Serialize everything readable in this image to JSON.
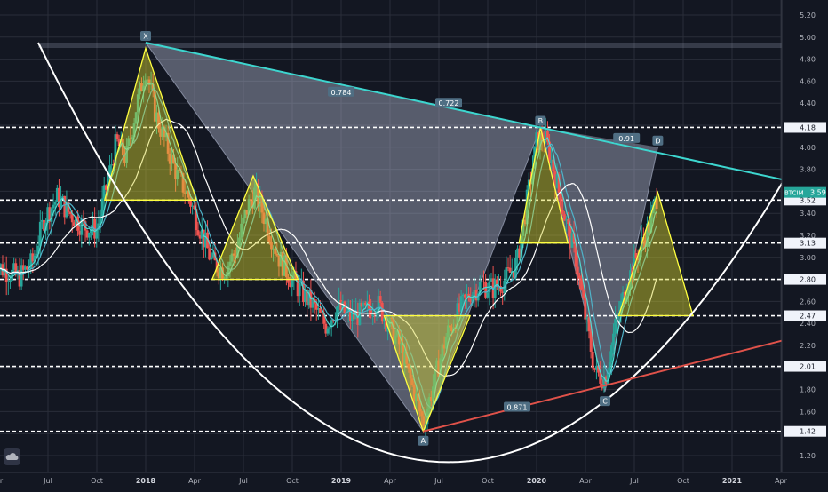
{
  "symbol": "BTCIM",
  "price_tag": "3.59",
  "logo_icon": "tradingview-cloud-icon",
  "colors": {
    "background": "#131722",
    "grid": "#2a2e39",
    "up": "#26a69a",
    "down": "#ef5350",
    "level_line": "#ffffff",
    "trend_top": "#3dd6cf",
    "trend_bottom": "#e0524a",
    "xabcd_fill": "#b4bdd4",
    "triangle_stroke": "#ffff40",
    "triangle_fill": "#d6d42e",
    "ma_fast": "#52d9d2",
    "ma_mid": "#4fb2c8",
    "ma_slow": "#ffffff",
    "price_tag_bg": "#26a69a"
  },
  "chart_data": {
    "type": "candlestick",
    "y_axis": {
      "ticks": [
        "5.20",
        "5.00",
        "4.80",
        "4.60",
        "4.40",
        "4.20",
        "4.00",
        "3.80",
        "3.60",
        "3.40",
        "3.20",
        "3.00",
        "2.80",
        "2.60",
        "2.40",
        "2.20",
        "2.00",
        "1.80",
        "1.60",
        "1.40",
        "1.20"
      ],
      "range": [
        1.12,
        5.27
      ]
    },
    "x_axis": {
      "ticks": [
        {
          "label": "pr",
          "t": 2017.25,
          "bold": false
        },
        {
          "label": "Jul",
          "t": 2017.5,
          "bold": false
        },
        {
          "label": "Oct",
          "t": 2017.75,
          "bold": false
        },
        {
          "label": "2018",
          "t": 2018.0,
          "bold": true
        },
        {
          "label": "Apr",
          "t": 2018.25,
          "bold": false
        },
        {
          "label": "Jul",
          "t": 2018.5,
          "bold": false
        },
        {
          "label": "Oct",
          "t": 2018.75,
          "bold": false
        },
        {
          "label": "2019",
          "t": 2019.0,
          "bold": true
        },
        {
          "label": "Apr",
          "t": 2019.25,
          "bold": false
        },
        {
          "label": "Jul",
          "t": 2019.5,
          "bold": false
        },
        {
          "label": "Oct",
          "t": 2019.75,
          "bold": false
        },
        {
          "label": "2020",
          "t": 2020.0,
          "bold": true
        },
        {
          "label": "Apr",
          "t": 2020.25,
          "bold": false
        },
        {
          "label": "Jul",
          "t": 2020.5,
          "bold": false
        },
        {
          "label": "Oct",
          "t": 2020.75,
          "bold": false
        },
        {
          "label": "2021",
          "t": 2021.0,
          "bold": true
        },
        {
          "label": "Apr",
          "t": 2021.25,
          "bold": false
        }
      ]
    },
    "levels": [
      "4.18",
      "3.52",
      "3.13",
      "2.80",
      "2.47",
      "2.01",
      "1.42"
    ],
    "xabcd_pattern": {
      "points": [
        {
          "label": "X",
          "t": 2018.0,
          "price": 4.95
        },
        {
          "label": "A",
          "t": 2019.42,
          "price": 1.42
        },
        {
          "label": "B",
          "t": 2020.02,
          "price": 4.18
        },
        {
          "label": "C",
          "t": 2020.35,
          "price": 1.78
        },
        {
          "label": "D",
          "t": 2020.62,
          "price": 4.0
        }
      ],
      "ratios": [
        {
          "label": "0.784",
          "t": 2019.0,
          "price": 4.5
        },
        {
          "label": "0.722",
          "t": 2019.55,
          "price": 4.4
        },
        {
          "label": "0.91",
          "t": 2020.46,
          "price": 4.08
        },
        {
          "label": "0.871",
          "t": 2019.9,
          "price": 1.64
        }
      ]
    },
    "trendlines": [
      {
        "name": "resistance",
        "from": {
          "t": 2018.0,
          "price": 4.95
        },
        "to": {
          "t": 2021.65,
          "price": 3.66
        }
      },
      {
        "name": "support",
        "from": {
          "t": 2019.42,
          "price": 1.42
        },
        "to": {
          "t": 2021.65,
          "price": 2.3
        }
      }
    ],
    "cup_curve": {
      "left": {
        "t": 2017.45,
        "price": 4.95
      },
      "bottom": {
        "t": 2019.55,
        "price": 1.14
      },
      "right": {
        "t": 2021.65,
        "price": 4.98
      }
    },
    "range_band": {
      "top": 4.95,
      "t_from": 2017.45,
      "t_to": 2021.65
    },
    "triangles": [
      {
        "apex": {
          "t": 2018.0,
          "price": 4.9
        },
        "base_left": {
          "t": 2017.79,
          "price": 3.52
        },
        "base_right": {
          "t": 2018.26,
          "price": 3.52
        }
      },
      {
        "apex": {
          "t": 2018.55,
          "price": 3.74
        },
        "base_left": {
          "t": 2018.34,
          "price": 2.8
        },
        "base_right": {
          "t": 2018.78,
          "price": 2.8
        }
      },
      {
        "apex": {
          "t": 2019.42,
          "price": 1.42
        },
        "base_left": {
          "t": 2019.22,
          "price": 2.47
        },
        "base_right": {
          "t": 2019.66,
          "price": 2.47
        }
      },
      {
        "apex": {
          "t": 2020.02,
          "price": 4.18
        },
        "base_left": {
          "t": 2019.91,
          "price": 3.13
        },
        "base_right": {
          "t": 2020.16,
          "price": 3.13
        }
      },
      {
        "apex": {
          "t": 2020.62,
          "price": 3.59
        },
        "base_left": {
          "t": 2020.42,
          "price": 2.47
        },
        "base_right": {
          "t": 2020.8,
          "price": 2.47
        }
      }
    ],
    "price_path": [
      {
        "t": 2017.22,
        "price": 2.95
      },
      {
        "t": 2017.28,
        "price": 2.88
      },
      {
        "t": 2017.35,
        "price": 2.82
      },
      {
        "t": 2017.42,
        "price": 2.95
      },
      {
        "t": 2017.48,
        "price": 3.35
      },
      {
        "t": 2017.55,
        "price": 3.55
      },
      {
        "t": 2017.6,
        "price": 3.42
      },
      {
        "t": 2017.68,
        "price": 3.28
      },
      {
        "t": 2017.75,
        "price": 3.25
      },
      {
        "t": 2017.8,
        "price": 3.65
      },
      {
        "t": 2017.85,
        "price": 4.05
      },
      {
        "t": 2017.9,
        "price": 3.9
      },
      {
        "t": 2017.95,
        "price": 4.35
      },
      {
        "t": 2018.0,
        "price": 4.72
      },
      {
        "t": 2018.05,
        "price": 4.3
      },
      {
        "t": 2018.1,
        "price": 4.05
      },
      {
        "t": 2018.16,
        "price": 3.75
      },
      {
        "t": 2018.22,
        "price": 3.55
      },
      {
        "t": 2018.28,
        "price": 3.25
      },
      {
        "t": 2018.34,
        "price": 2.95
      },
      {
        "t": 2018.4,
        "price": 2.88
      },
      {
        "t": 2018.46,
        "price": 3.05
      },
      {
        "t": 2018.52,
        "price": 3.45
      },
      {
        "t": 2018.56,
        "price": 3.6
      },
      {
        "t": 2018.62,
        "price": 3.3
      },
      {
        "t": 2018.68,
        "price": 3.0
      },
      {
        "t": 2018.74,
        "price": 2.82
      },
      {
        "t": 2018.8,
        "price": 2.68
      },
      {
        "t": 2018.86,
        "price": 2.55
      },
      {
        "t": 2018.92,
        "price": 2.38
      },
      {
        "t": 2018.98,
        "price": 2.55
      },
      {
        "t": 2019.05,
        "price": 2.45
      },
      {
        "t": 2019.12,
        "price": 2.5
      },
      {
        "t": 2019.18,
        "price": 2.6
      },
      {
        "t": 2019.24,
        "price": 2.4
      },
      {
        "t": 2019.3,
        "price": 2.2
      },
      {
        "t": 2019.36,
        "price": 1.85
      },
      {
        "t": 2019.42,
        "price": 1.5
      },
      {
        "t": 2019.48,
        "price": 1.9
      },
      {
        "t": 2019.54,
        "price": 2.3
      },
      {
        "t": 2019.6,
        "price": 2.5
      },
      {
        "t": 2019.66,
        "price": 2.68
      },
      {
        "t": 2019.72,
        "price": 2.75
      },
      {
        "t": 2019.78,
        "price": 2.72
      },
      {
        "t": 2019.84,
        "price": 2.8
      },
      {
        "t": 2019.9,
        "price": 2.95
      },
      {
        "t": 2019.95,
        "price": 3.5
      },
      {
        "t": 2020.0,
        "price": 4.05
      },
      {
        "t": 2020.04,
        "price": 4.1
      },
      {
        "t": 2020.08,
        "price": 3.85
      },
      {
        "t": 2020.12,
        "price": 3.55
      },
      {
        "t": 2020.16,
        "price": 3.25
      },
      {
        "t": 2020.2,
        "price": 3.0
      },
      {
        "t": 2020.25,
        "price": 2.45
      },
      {
        "t": 2020.3,
        "price": 1.95
      },
      {
        "t": 2020.35,
        "price": 1.9
      },
      {
        "t": 2020.4,
        "price": 2.35
      },
      {
        "t": 2020.46,
        "price": 2.75
      },
      {
        "t": 2020.52,
        "price": 3.05
      },
      {
        "t": 2020.58,
        "price": 3.3
      },
      {
        "t": 2020.62,
        "price": 3.59
      }
    ]
  }
}
